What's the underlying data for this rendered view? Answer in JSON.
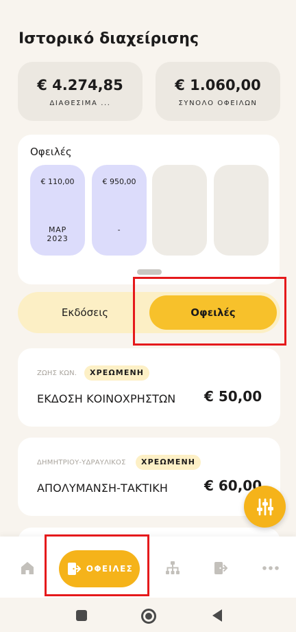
{
  "page": {
    "title": "Ιστορικό διαχείρισης"
  },
  "summary": {
    "available": {
      "amount": "€ 4.274,85",
      "label": "ΔΙΑΘΕΣΙΜΑ ..."
    },
    "total_debts": {
      "amount": "€ 1.060,00",
      "label": "ΣΥΝΟΛΟ ΟΦΕΙΛΩΝ"
    }
  },
  "debts_panel": {
    "title": "Οφειλές",
    "columns": [
      {
        "amount": "€ 110,00",
        "label": "ΜΑΡ\n2023"
      },
      {
        "amount": "€ 950,00",
        "label": "-"
      },
      {
        "amount": "",
        "label": ""
      },
      {
        "amount": "",
        "label": ""
      }
    ]
  },
  "toggle": {
    "issues": "Εκδόσεις",
    "debts": "Οφειλές",
    "selected": "debts"
  },
  "transactions": [
    {
      "subtitle": "ΖΩΗΣ ΚΩΝ.",
      "badge": "ΧΡΕΩΜΕΝΗ",
      "title": "ΕΚΔΟΣΗ ΚΟΙΝΟΧΡΗΣΤΩΝ",
      "amount": "€ 50,00"
    },
    {
      "subtitle": "ΔΗΜΗΤΡΙΟΥ-ΥΔΡΑΥΛΙΚΟΣ",
      "badge": "ΧΡΕΩΜΕΝΗ",
      "title": "ΑΠΟΛΥΜΑΝΣΗ-ΤΑΚΤΙΚΗ",
      "amount": "€ 60,00"
    }
  ],
  "fab": {
    "icon": "sliders-icon"
  },
  "bottom_nav": {
    "items": [
      {
        "icon": "home-icon"
      },
      {
        "icon": "exit-door-icon",
        "label": "ΟΦΕΙΛΕΣ",
        "active": true
      },
      {
        "icon": "org-tree-icon"
      },
      {
        "icon": "exit-door-icon"
      },
      {
        "icon": "more-dots-icon"
      }
    ]
  },
  "system_nav": {
    "icons": [
      "recents-square-icon",
      "home-circle-icon",
      "back-triangle-icon"
    ]
  },
  "colors": {
    "accent": "#f5b31a",
    "toggle_bg": "#fcefc5",
    "badge_bg": "#fdf0c6",
    "debt_column": "#dcdcfb",
    "highlight": "#e5191b",
    "background": "#f8f4ee"
  }
}
